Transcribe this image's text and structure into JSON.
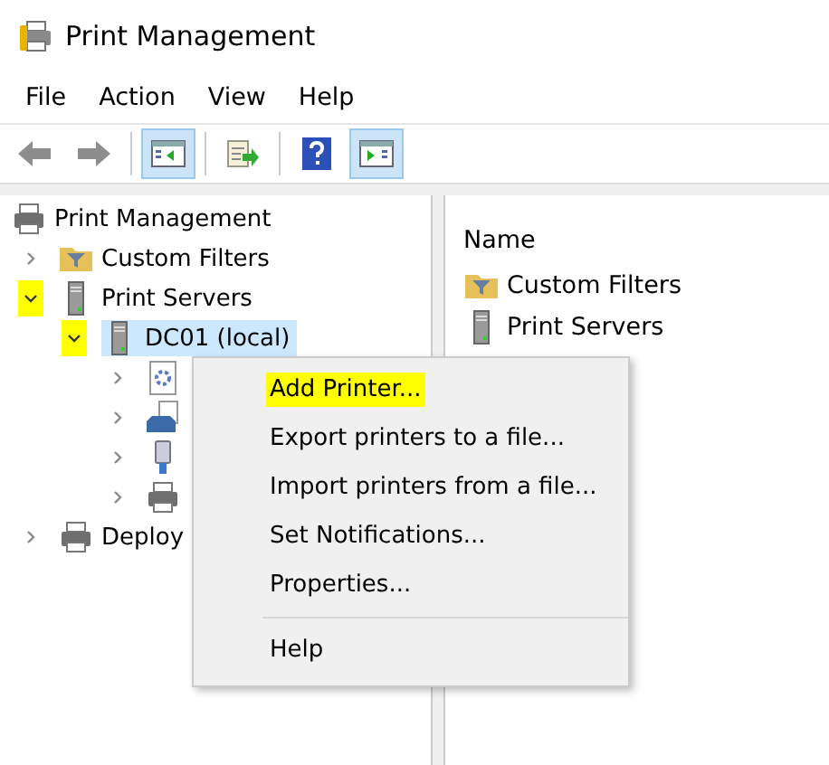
{
  "window": {
    "title": "Print Management"
  },
  "menu": [
    {
      "label": "File"
    },
    {
      "label": "Action"
    },
    {
      "label": "View"
    },
    {
      "label": "Help"
    }
  ],
  "toolbar": [
    {
      "kind": "back",
      "pressed": false
    },
    {
      "kind": "forward",
      "pressed": false
    },
    {
      "kind": "separator",
      "pressed": false
    },
    {
      "kind": "console-tree",
      "pressed": true
    },
    {
      "kind": "separator",
      "pressed": false
    },
    {
      "kind": "export",
      "pressed": false
    },
    {
      "kind": "separator",
      "pressed": false
    },
    {
      "kind": "help",
      "pressed": false
    },
    {
      "kind": "action-pane",
      "pressed": true
    }
  ],
  "tree": {
    "label": "Print Management",
    "kind": "printer",
    "children": [
      {
        "label": "Custom Filters",
        "kind": "filter-folder",
        "expanded": false,
        "selected": false,
        "highlighted": false
      },
      {
        "label": "Print Servers",
        "kind": "server",
        "expanded": true,
        "selected": false,
        "highlighted": true,
        "children": [
          {
            "label": "DC01 (local)",
            "kind": "server",
            "expanded": true,
            "selected": true,
            "highlighted": true,
            "children": [
              {
                "kind": "gear-doc",
                "expanded": false,
                "selected": false,
                "highlighted": false
              },
              {
                "kind": "tray",
                "expanded": false,
                "selected": false,
                "highlighted": false
              },
              {
                "kind": "port",
                "expanded": false,
                "selected": false,
                "highlighted": false
              },
              {
                "kind": "printer",
                "expanded": false,
                "selected": false,
                "highlighted": false
              }
            ]
          }
        ]
      },
      {
        "label": "Deploy",
        "kind": "printer",
        "expanded": false,
        "selected": false,
        "highlighted": false
      }
    ]
  },
  "list": {
    "column": "Name",
    "items": [
      {
        "label": "Custom Filters",
        "kind": "filter-folder"
      },
      {
        "label": "Print Servers",
        "kind": "server"
      }
    ]
  },
  "context_menu": [
    {
      "kind": "item",
      "label": "Add Printer...",
      "highlighted": true
    },
    {
      "kind": "item",
      "label": "Export printers to a file...",
      "highlighted": false
    },
    {
      "kind": "item",
      "label": "Import printers from a file...",
      "highlighted": false
    },
    {
      "kind": "item",
      "label": "Set Notifications...",
      "highlighted": false
    },
    {
      "kind": "item",
      "label": "Properties...",
      "highlighted": false
    },
    {
      "kind": "separator"
    },
    {
      "kind": "item",
      "label": "Help",
      "highlighted": false
    }
  ]
}
